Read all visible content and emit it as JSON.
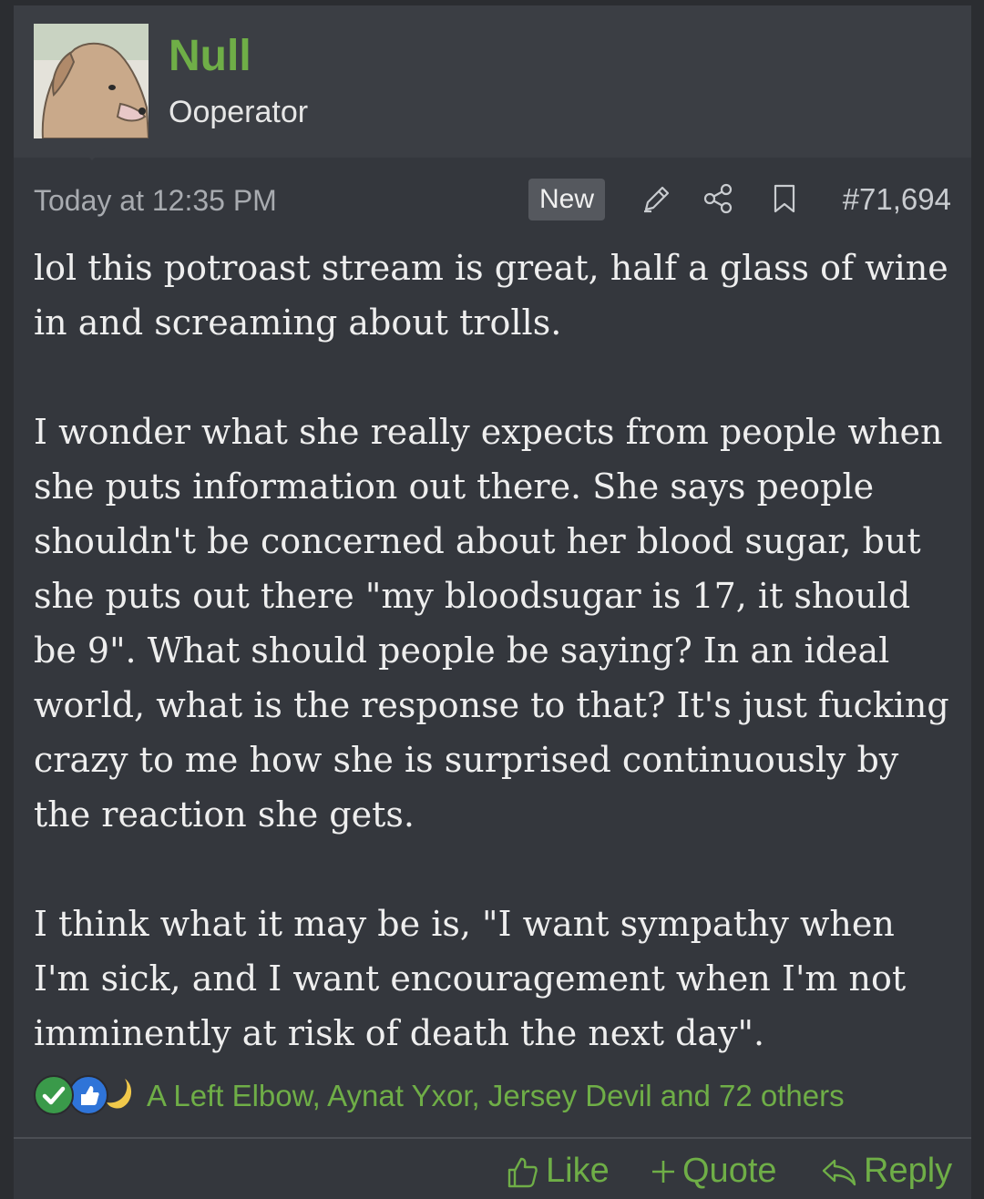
{
  "user": {
    "name": "Null",
    "title": "Ooperator",
    "avatar_icon": "dog-avatar"
  },
  "meta": {
    "date": "Today at 12:35 PM",
    "new_badge": "New",
    "post_number": "#71,694",
    "icons": [
      "pencil-icon",
      "share-icon",
      "bookmark-icon"
    ]
  },
  "post": {
    "paragraphs": [
      "lol this potroast stream is great, half a glass of wine in and screaming about trolls.",
      "I wonder what she really expects from people when she puts information out there. She says people shouldn't be concerned about her blood sugar, but she puts out there \"my bloodsugar is 17, it should be 9\". What should people be saying? In an ideal world, what is the response to that? It's just fucking crazy to me how she is surprised continuously by the reaction she gets.",
      "I think what it may be is, \"I want sympathy when I'm sick, and I want encouragement when I'm not imminently at risk of death the next day\"."
    ]
  },
  "reactions": {
    "icons": [
      "checkmark-icon",
      "thumbs-up-icon",
      "moon-icon"
    ],
    "names": "A Left Elbow, Aynat Yxor, Jersey Devil and 72 others"
  },
  "actions": {
    "like": "Like",
    "quote": "Quote",
    "reply": "Reply"
  },
  "colors": {
    "accent": "#6fae47",
    "background": "#34373d",
    "header": "#3b3e44"
  }
}
